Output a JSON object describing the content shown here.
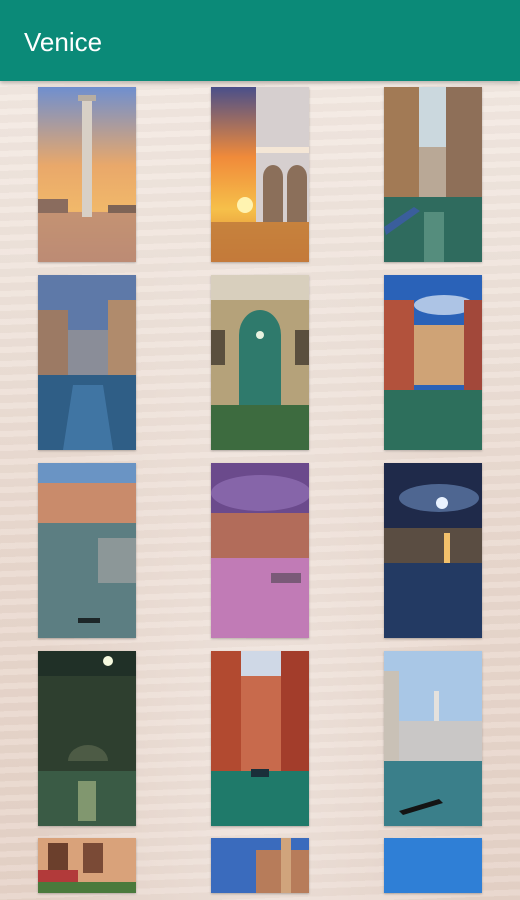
{
  "appbar": {
    "title": "Venice",
    "color": "#0b8a78"
  },
  "gallery": {
    "items": [
      {
        "name": "campanile-sunset-thumbnail"
      },
      {
        "name": "doges-palace-sunset-thumbnail"
      },
      {
        "name": "canal-boats-thumbnail"
      },
      {
        "name": "canal-reflection-thumbnail"
      },
      {
        "name": "green-door-thumbnail"
      },
      {
        "name": "blue-sky-canal-thumbnail"
      },
      {
        "name": "grand-canal-thumbnail"
      },
      {
        "name": "purple-sky-canal-thumbnail"
      },
      {
        "name": "moonlit-canal-thumbnail"
      },
      {
        "name": "night-bridge-thumbnail"
      },
      {
        "name": "red-houses-canal-thumbnail"
      },
      {
        "name": "gondola-canal-thumbnail"
      },
      {
        "name": "flower-balcony-thumbnail"
      },
      {
        "name": "rooftops-thumbnail"
      },
      {
        "name": "blue-sky-thumbnail"
      }
    ]
  }
}
